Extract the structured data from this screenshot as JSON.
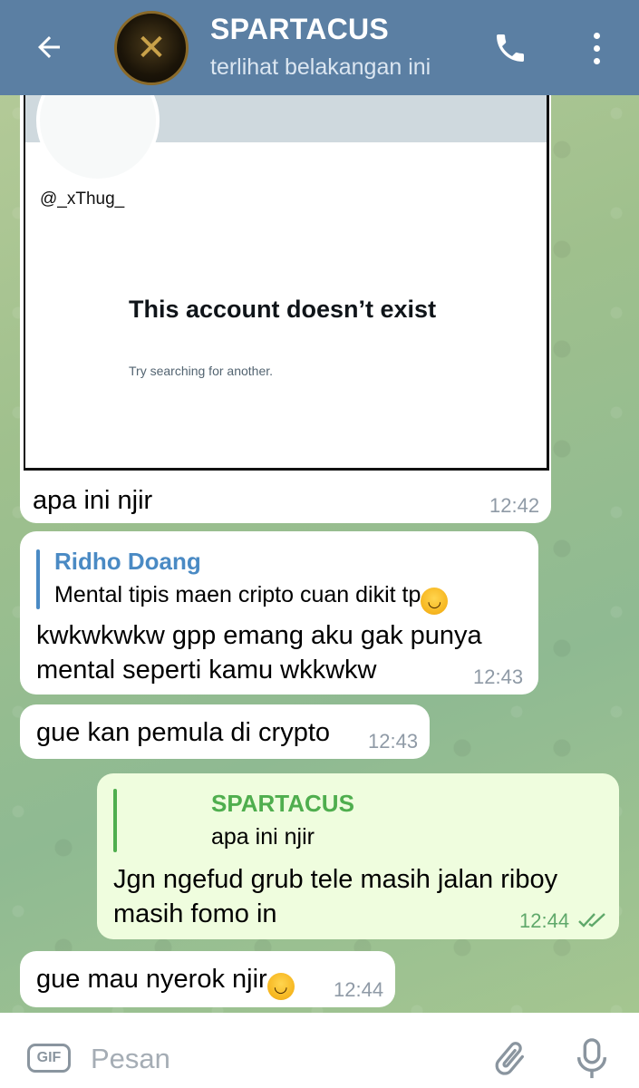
{
  "header": {
    "title": "SPARTACUS",
    "status": "terlihat belakangan ini",
    "avatar_glyph": "✕"
  },
  "messages": {
    "image_msg": {
      "screenshot": {
        "handle": "@_xThug_",
        "title": "This account doesn’t exist",
        "subtitle": "Try searching for another."
      },
      "caption": "apa ini njir",
      "time": "12:42"
    },
    "reply_msg": {
      "quote_name": "Ridho Doang",
      "quote_text": "Mental tipis maen cripto cuan dikit tp",
      "text": "kwkwkwkw gpp emang aku gak punya mental seperti kamu wkkwkw",
      "time": "12:43"
    },
    "msg3": {
      "text": "gue kan pemula di crypto",
      "time": "12:43"
    },
    "out_msg": {
      "quote_name": "SPARTACUS",
      "quote_text": "apa ini njir",
      "text": "Jgn ngefud grub tele masih jalan riboy masih fomo in",
      "time": "12:44"
    },
    "msg5": {
      "text": "gue mau nyerok njir",
      "time": "12:44"
    }
  },
  "emoji": "😂",
  "input": {
    "gif_label": "GIF",
    "placeholder": "Pesan"
  },
  "colors": {
    "header_bg": "#5b7fa3",
    "incoming_bubble": "#ffffff",
    "outgoing_bubble": "#effdde",
    "reply_accent_in": "#4a8ac4",
    "reply_accent_out": "#4fae4e"
  }
}
